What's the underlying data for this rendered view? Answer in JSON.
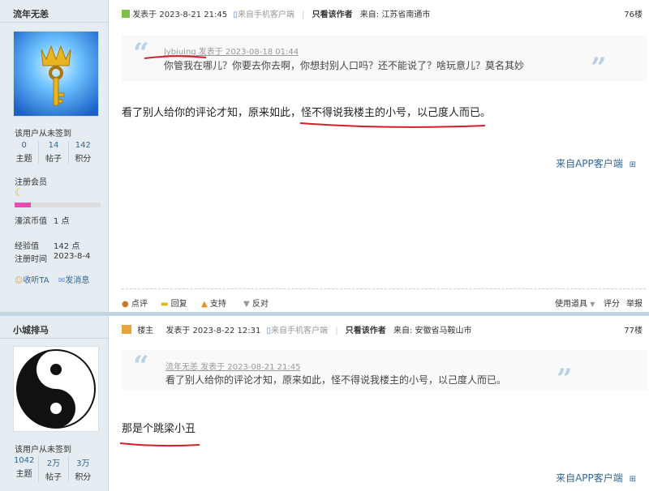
{
  "post1": {
    "username": "流年无恙",
    "signin": "该用户从未签到",
    "stats": [
      {
        "num": "0",
        "label": "主题"
      },
      {
        "num": "14",
        "label": "帖子"
      },
      {
        "num": "142",
        "label": "积分"
      }
    ],
    "group": "注册会员",
    "cash_label": "濠滨币值",
    "cash_value": "1 点",
    "exp_label": "经验值",
    "exp_value": "142 点",
    "reg_label": "注册时间",
    "reg_value": "2023-8-4",
    "listen": "收听TA",
    "message": "发消息",
    "posted": "发表于 2023-8-21 21:45",
    "client": "来自手机客户端",
    "only_author": "只看该作者",
    "location": "来自: 江苏省南通市",
    "floor": "76楼",
    "quote_author": "lybiuing 发表于 2023-08-18 01:44",
    "quote_text": "你管我在哪儿？你要去你去啊，你想封别人口吗？还不能说了？啥玩意儿？莫名其妙",
    "content": "看了别人给你的评论才知，原来如此，怪不得说我楼主的小号，以己度人而已。",
    "from_app": "来自APP客户端",
    "actions": {
      "comment": "点评",
      "reply": "回复",
      "support": "支持",
      "oppose": "反对",
      "tools": "使用道具",
      "rate": "评分",
      "report": "举报"
    }
  },
  "post2": {
    "username": "小城排马",
    "signin": "该用户从未签到",
    "stats": [
      {
        "num": "1042",
        "label": "主题"
      },
      {
        "num": "2万",
        "label": "帖子"
      },
      {
        "num": "3万",
        "label": "积分"
      }
    ],
    "owner": "楼主",
    "posted": "发表于 2023-8-22 12:31",
    "client": "来自手机客户端",
    "only_author": "只看该作者",
    "location": "来自: 安徽省马鞍山市",
    "floor": "77楼",
    "quote_author": "流年无恙 发表于 2023-08-21 21:45",
    "quote_text": "看了别人给你的评论才知，原来如此，怪不得说我楼主的小号，以己度人而已。",
    "content": "那是个跳梁小丑",
    "from_app": "来自APP客户端"
  }
}
